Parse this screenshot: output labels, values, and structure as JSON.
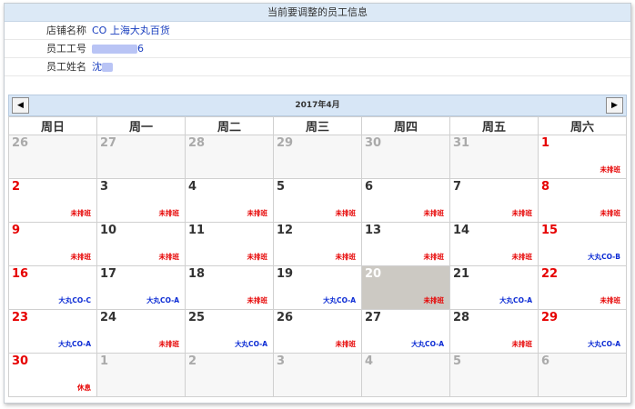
{
  "info": {
    "title": "当前要调整的员工信息",
    "store_label": "店铺名称",
    "store_value": "CO 上海大丸百货",
    "emp_id_label": "员工工号",
    "emp_id_value": "6",
    "emp_name_label": "员工姓名",
    "emp_name_value": "沈"
  },
  "calendar": {
    "month_title": "2017年4月",
    "prev_icon": "◀",
    "next_icon": "▶",
    "weekdays": [
      "周日",
      "周一",
      "周二",
      "周三",
      "周四",
      "周五",
      "周六"
    ],
    "weeks": [
      [
        {
          "d": "26",
          "other": true
        },
        {
          "d": "27",
          "other": true
        },
        {
          "d": "28",
          "other": true
        },
        {
          "d": "29",
          "other": true
        },
        {
          "d": "30",
          "other": true
        },
        {
          "d": "31",
          "other": true
        },
        {
          "d": "1",
          "shift": "未排班",
          "type": "none"
        }
      ],
      [
        {
          "d": "2",
          "shift": "未排班",
          "type": "none"
        },
        {
          "d": "3",
          "shift": "未排班",
          "type": "none"
        },
        {
          "d": "4",
          "shift": "未排班",
          "type": "none"
        },
        {
          "d": "5",
          "shift": "未排班",
          "type": "none"
        },
        {
          "d": "6",
          "shift": "未排班",
          "type": "none"
        },
        {
          "d": "7",
          "shift": "未排班",
          "type": "none"
        },
        {
          "d": "8",
          "shift": "未排班",
          "type": "none"
        }
      ],
      [
        {
          "d": "9",
          "shift": "未排班",
          "type": "none"
        },
        {
          "d": "10",
          "shift": "未排班",
          "type": "none"
        },
        {
          "d": "11",
          "shift": "未排班",
          "type": "none"
        },
        {
          "d": "12",
          "shift": "未排班",
          "type": "none"
        },
        {
          "d": "13",
          "shift": "未排班",
          "type": "none"
        },
        {
          "d": "14",
          "shift": "未排班",
          "type": "none"
        },
        {
          "d": "15",
          "shift": "大丸CO-B",
          "type": "sched"
        }
      ],
      [
        {
          "d": "16",
          "shift": "大丸CO-C",
          "type": "sched"
        },
        {
          "d": "17",
          "shift": "大丸CO-A",
          "type": "sched"
        },
        {
          "d": "18",
          "shift": "未排班",
          "type": "none"
        },
        {
          "d": "19",
          "shift": "大丸CO-A",
          "type": "sched"
        },
        {
          "d": "20",
          "shift": "未排班",
          "type": "none",
          "today": true
        },
        {
          "d": "21",
          "shift": "大丸CO-A",
          "type": "sched"
        },
        {
          "d": "22",
          "shift": "未排班",
          "type": "none"
        }
      ],
      [
        {
          "d": "23",
          "shift": "大丸CO-A",
          "type": "sched"
        },
        {
          "d": "24",
          "shift": "未排班",
          "type": "none"
        },
        {
          "d": "25",
          "shift": "大丸CO-A",
          "type": "sched"
        },
        {
          "d": "26",
          "shift": "未排班",
          "type": "none"
        },
        {
          "d": "27",
          "shift": "大丸CO-A",
          "type": "sched"
        },
        {
          "d": "28",
          "shift": "未排班",
          "type": "none"
        },
        {
          "d": "29",
          "shift": "大丸CO-A",
          "type": "sched"
        }
      ],
      [
        {
          "d": "30",
          "shift": "休息",
          "type": "none"
        },
        {
          "d": "1",
          "other": true
        },
        {
          "d": "2",
          "other": true
        },
        {
          "d": "3",
          "other": true
        },
        {
          "d": "4",
          "other": true
        },
        {
          "d": "5",
          "other": true
        },
        {
          "d": "6",
          "other": true
        }
      ]
    ]
  },
  "colors": {
    "header_bg": "#dce9f6",
    "weekend_red": "#e60000",
    "scheduled_blue": "#0b2bd4",
    "today_bg": "#ccc9c3"
  }
}
